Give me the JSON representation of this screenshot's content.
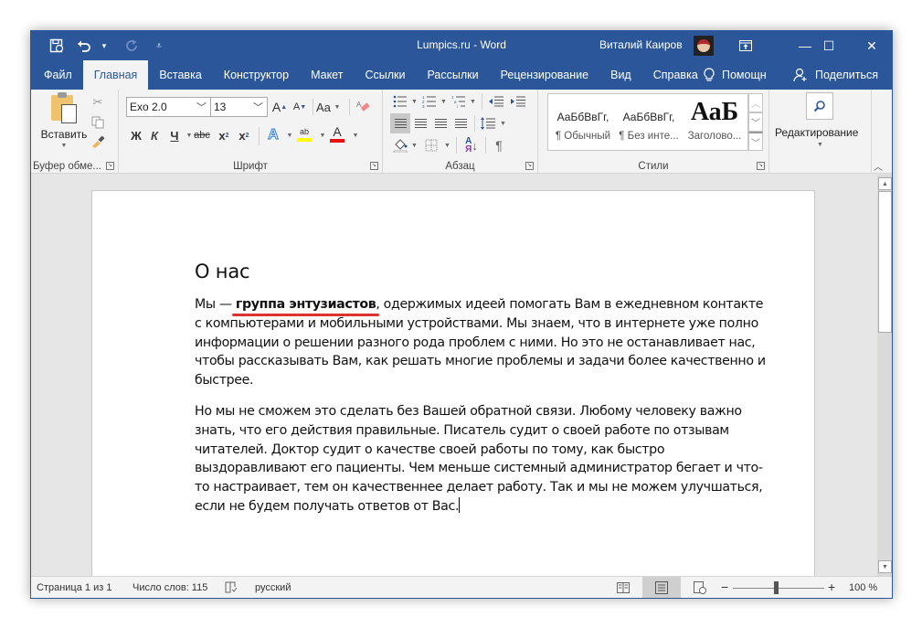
{
  "titlebar": {
    "title": "Lumpics.ru  -  Word",
    "user_name": "Виталий Каиров",
    "qat": {
      "save_icon": "save-autosave-icon",
      "undo_icon": "undo-icon",
      "redo_icon": "redo-icon",
      "customize_icon": "customize-qat-icon"
    },
    "icons": {
      "ribbon_display": "⊡",
      "minimize": "—",
      "maximize": "☐",
      "close": "✕"
    }
  },
  "tabs": [
    {
      "label": "Файл",
      "active": false
    },
    {
      "label": "Главная",
      "active": true
    },
    {
      "label": "Вставка",
      "active": false
    },
    {
      "label": "Конструктор",
      "active": false
    },
    {
      "label": "Макет",
      "active": false
    },
    {
      "label": "Ссылки",
      "active": false
    },
    {
      "label": "Рассылки",
      "active": false
    },
    {
      "label": "Рецензирование",
      "active": false
    },
    {
      "label": "Вид",
      "active": false
    },
    {
      "label": "Справка",
      "active": false
    }
  ],
  "tabs_right": {
    "help_search": "Помощн",
    "share": "Поделиться"
  },
  "ribbon": {
    "clipboard": {
      "label": "Буфер обме...",
      "paste": "Вставить"
    },
    "font": {
      "label": "Шрифт",
      "font_name": "Exo 2.0",
      "font_size": "13",
      "grow": "A",
      "shrink": "A",
      "change_case": "Aa",
      "bold": "Ж",
      "italic": "К",
      "underline": "Ч",
      "strikethrough": "abc",
      "subscript": "x",
      "superscript": "x",
      "text_effects": "A",
      "highlight": "ab",
      "font_color": "A",
      "highlight_color": "#ffff00",
      "font_color_value": "#e81010"
    },
    "paragraph": {
      "label": "Абзац",
      "sort": "А↓",
      "pilcrow": "¶"
    },
    "styles": {
      "label": "Стили",
      "items": [
        {
          "sample": "АаБбВвГг,",
          "name": "¶ Обычный"
        },
        {
          "sample": "АаБбВвГг,",
          "name": "¶ Без инте..."
        },
        {
          "sample": "АаБ",
          "name": "Заголово..."
        }
      ]
    },
    "editing": {
      "label": "Редактирование"
    }
  },
  "document": {
    "heading": "О нас",
    "p1_before": "Мы — ",
    "p1_bold": "группа энтузиастов",
    "p1_after": ", одержимых идеей помогать Вам в ежедневном контакте с компьютерами и мобильными устройствами. Мы знаем, что в интернете уже полно информации о решении разного рода проблем с ними. Но это не останавливает нас, чтобы рассказывать Вам, как решать многие проблемы и задачи более качественно и быстрее.",
    "p2": "Но мы не сможем это сделать без Вашей обратной связи. Любому человеку важно знать, что его действия правильные. Писатель судит о своей работе по отзывам читателей. Доктор судит о качестве своей работы по тому, как быстро выздоравливают его пациенты. Чем меньше системный администратор бегает и что-то настраивает, тем он качественнее делает работу. Так и мы не можем улучшаться, если не будем получать ответов от Вас."
  },
  "statusbar": {
    "page": "Страница 1 из 1",
    "words": "Число слов: 115",
    "language": "русский",
    "zoom_minus": "−",
    "zoom_plus": "+",
    "zoom_level": "100 %",
    "zoom_percent": 100
  },
  "colors": {
    "accent": "#2b579a",
    "ribbon_bg": "#f3f3f3",
    "canvas_bg": "#e6e6e6",
    "underline_mark": "#e03030"
  }
}
